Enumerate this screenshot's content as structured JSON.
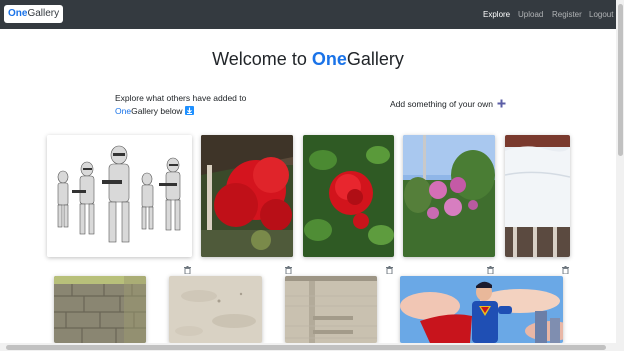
{
  "navbar": {
    "brand_prefix": "One",
    "brand_suffix": "Gallery",
    "links": {
      "explore": "Explore",
      "upload": "Upload",
      "register": "Register",
      "logout": "Logout"
    }
  },
  "heading": {
    "prefix": "Welcome to ",
    "brand_prefix": "One",
    "brand_suffix": "Gallery"
  },
  "explore_text": {
    "line1": "Explore what others have added to",
    "brand_prefix": "One",
    "line2_suffix": "Gallery below"
  },
  "add_text": "Add something of your own",
  "icons": {
    "download": "download-icon",
    "plus": "plus-icon",
    "trash": "trash-icon"
  },
  "colors": {
    "navbar": "#343a40",
    "brand_accent": "#1a73e8",
    "add_icon": "#5b5ea6"
  }
}
